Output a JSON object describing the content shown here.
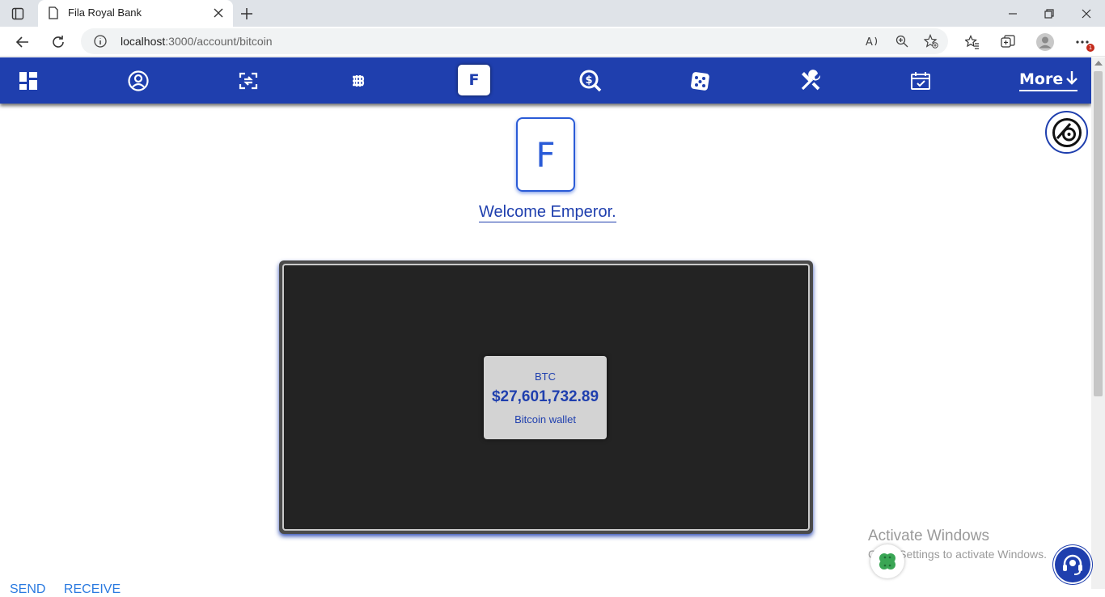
{
  "browser": {
    "tab_title": "Fila Royal Bank",
    "url_host": "localhost",
    "url_rest": ":3000/account/bitcoin",
    "notification_count": "1"
  },
  "nav": {
    "active_letter": "F",
    "more_label": "More",
    "icons": [
      "dashboard-icon",
      "profile-icon",
      "transfer-icon",
      "bitcoin-icon",
      "search-dollar-icon",
      "dice-icon",
      "tools-icon",
      "calendar-icon"
    ]
  },
  "profile": {
    "avatar_letter": "F",
    "welcome": "Welcome Emperor."
  },
  "wallet": {
    "code": "BTC",
    "amount": "$27,601,732.89",
    "label": "Bitcoin wallet"
  },
  "windows_watermark": {
    "line1": "Activate Windows",
    "line2": "Go to Settings to activate Windows."
  },
  "actions": {
    "send": "SEND",
    "receive": "RECEIVE"
  },
  "colors": {
    "nav_blue": "#1f3fae",
    "accent_blue": "#2a5bd7",
    "wallet_bg": "#232323",
    "card_bg": "#d3d3d3"
  }
}
